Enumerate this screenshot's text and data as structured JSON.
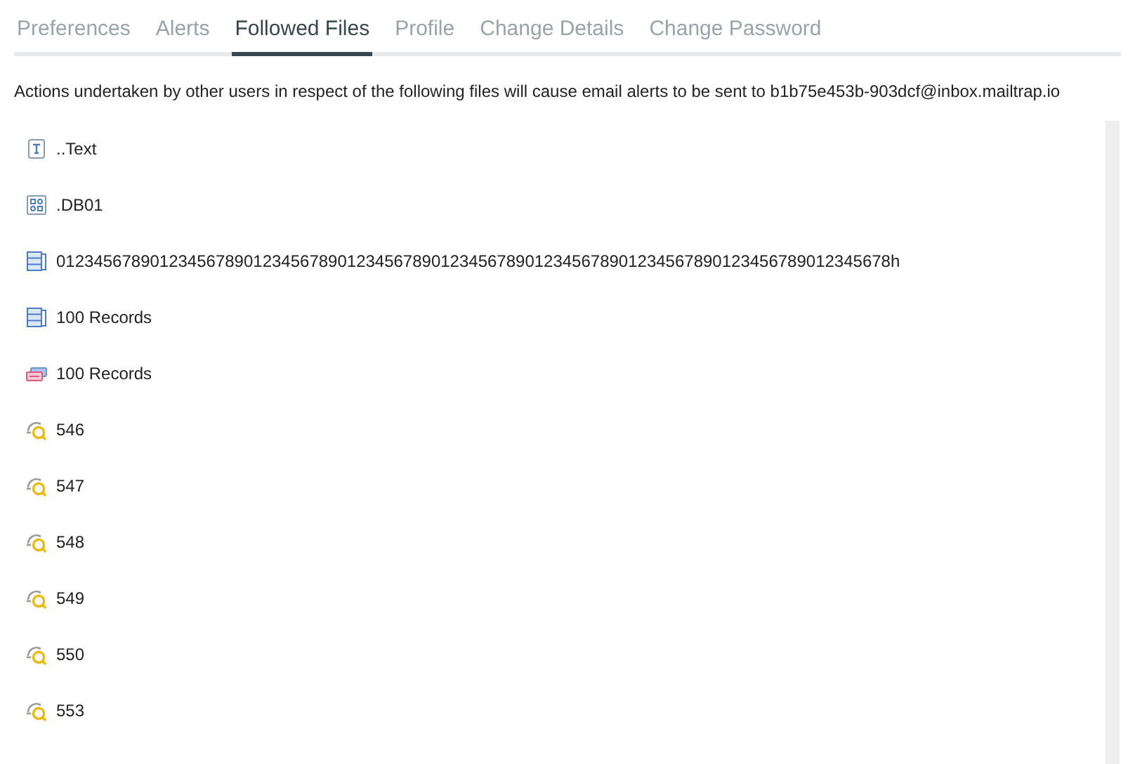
{
  "tabs": [
    {
      "label": "Preferences",
      "selected": false
    },
    {
      "label": "Alerts",
      "selected": false
    },
    {
      "label": "Followed Files",
      "selected": true
    },
    {
      "label": "Profile",
      "selected": false
    },
    {
      "label": "Change Details",
      "selected": false
    },
    {
      "label": "Change Password",
      "selected": false
    }
  ],
  "intro": "Actions undertaken by other users in respect of the following files will cause email alerts to be sent to b1b75e453b-903dcf@inbox.mailtrap.io",
  "files": [
    {
      "kind": "text",
      "name": "..Text"
    },
    {
      "kind": "dashboard",
      "name": ".DB01"
    },
    {
      "kind": "table",
      "name": "01234567890123456789012345678901234567890123456789012345678901234567890123456789012345678h"
    },
    {
      "kind": "table",
      "name": "100 Records"
    },
    {
      "kind": "records",
      "name": "100 Records"
    },
    {
      "kind": "query",
      "name": "546"
    },
    {
      "kind": "query",
      "name": "547"
    },
    {
      "kind": "query",
      "name": "548"
    },
    {
      "kind": "query",
      "name": "549"
    },
    {
      "kind": "query",
      "name": "550"
    },
    {
      "kind": "query",
      "name": "553"
    }
  ]
}
